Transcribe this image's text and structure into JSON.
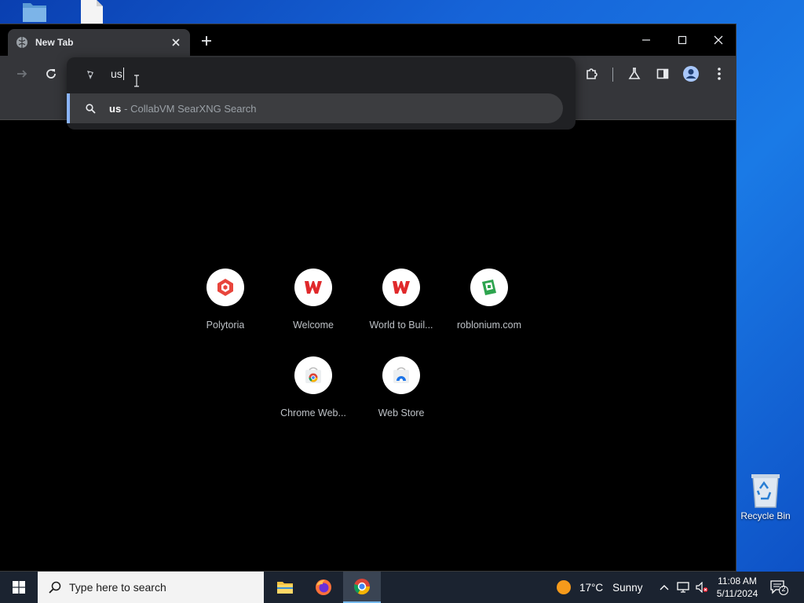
{
  "desktop": {
    "icons": [
      {
        "name": "folder"
      },
      {
        "name": "file"
      }
    ],
    "recycle_bin": {
      "label": "Recycle Bin"
    }
  },
  "browser": {
    "tab": {
      "title": "New Tab"
    },
    "omnibox": {
      "query": "us",
      "suggestion": {
        "query": "us",
        "description": "- CollabVM SearXNG Search"
      }
    },
    "shortcuts": [
      {
        "label": "Polytoria",
        "icon": "polytoria-icon",
        "color": "#e8453c"
      },
      {
        "label": "Welcome",
        "icon": "w-logo-icon",
        "color": "#e0292b"
      },
      {
        "label": "World to Buil...",
        "icon": "w-logo-icon",
        "color": "#e0292b"
      },
      {
        "label": "roblonium.com",
        "icon": "roblonium-icon",
        "color": "#2da44e"
      },
      {
        "label": "Chrome Web...",
        "icon": "chrome-web-store-icon",
        "color": "#4285f4"
      },
      {
        "label": "Web Store",
        "icon": "web-store-icon",
        "color": "#1a73e8"
      }
    ]
  },
  "taskbar": {
    "search_placeholder": "Type here to search",
    "weather": {
      "temp": "17°C",
      "condition": "Sunny"
    },
    "clock": {
      "time": "11:08 AM",
      "date": "5/11/2024"
    },
    "notifications_count": "2"
  }
}
